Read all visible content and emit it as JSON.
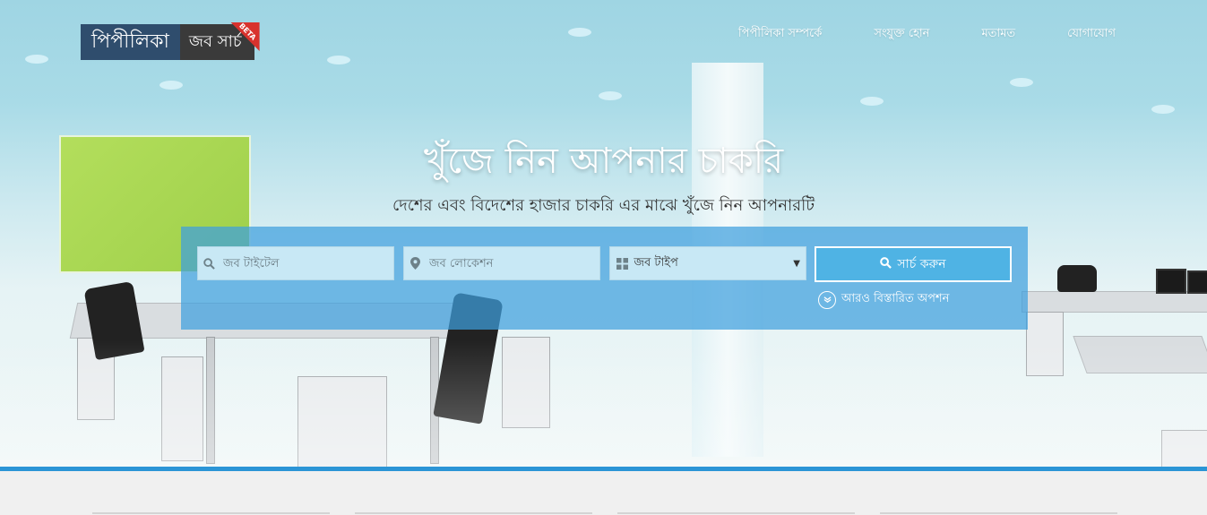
{
  "header": {
    "logo_left": "পিপীলিকা",
    "logo_right": "জব সার্চ",
    "logo_badge": "BETA",
    "nav": [
      {
        "label": "পিপীলিকা সম্পর্কে"
      },
      {
        "label": "সংযুক্ত হোন"
      },
      {
        "label": "মতামত"
      },
      {
        "label": "যোগাযোগ"
      }
    ]
  },
  "hero": {
    "title": "খুঁজে নিন আপনার চাকরি",
    "subtitle": "দেশের এবং বিদেশের হাজার চাকরি এর মাঝে খুঁজে নিন আপনারটি"
  },
  "search": {
    "title_placeholder": "জব টাইটেল",
    "location_placeholder": "জব লোকেশন",
    "job_type_value": "জব টাইপ",
    "button_label": "সার্চ করুন",
    "more_options": "আরও বিস্তারিত অপশন"
  },
  "icons": {
    "search": "search-icon",
    "location": "map-marker-icon",
    "type": "grid-icon",
    "chevron": "chevron-down-icon"
  },
  "colors": {
    "accent": "#2b95d6",
    "panel": "#3fa0de",
    "button": "#4fb3e4",
    "logo_left_bg": "#2f4d6d",
    "logo_right_bg": "#3a3a3a",
    "badge": "#d8322d"
  }
}
